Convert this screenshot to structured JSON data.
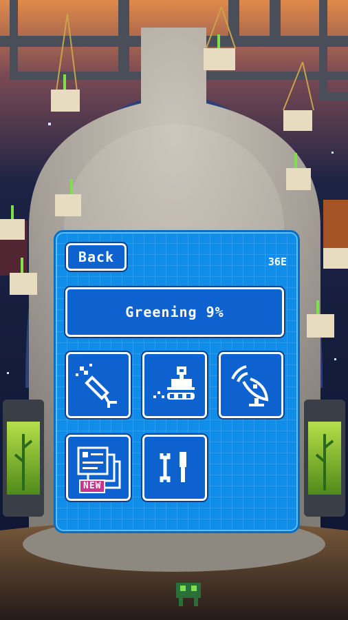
{
  "panel": {
    "back_label": "Back",
    "currency_value": "36E",
    "progress_label": "Greening 9%",
    "progress_percent": 9
  },
  "menu_tiles": [
    {
      "icon": "telescope-icon"
    },
    {
      "icon": "rover-icon"
    },
    {
      "icon": "satellite-dish-icon"
    },
    {
      "icon": "blueprint-icon",
      "badge": "NEW"
    },
    {
      "icon": "tools-icon"
    }
  ],
  "colors": {
    "panel_blue": "#0f8de8",
    "button_blue": "#0e62cf",
    "badge_pink": "#c8358c",
    "dome_grey": "#a8a39c",
    "plant_green": "#7fe04a"
  }
}
